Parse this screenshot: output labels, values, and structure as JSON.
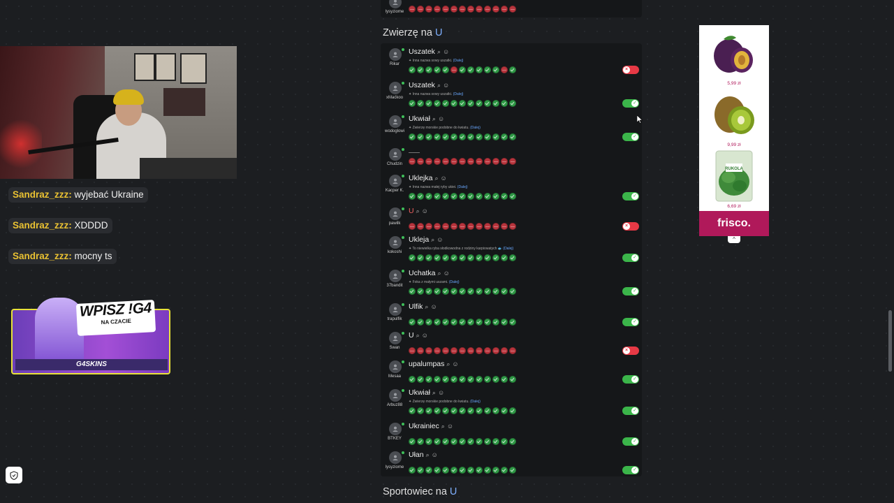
{
  "chat": [
    {
      "user": "Sandraz_zzz:",
      "text": "wyjebać Ukraine"
    },
    {
      "user": "Sandraz_zzz:",
      "text": "XDDDD"
    },
    {
      "user": "Sandraz_zzz:",
      "text": "mocny ts"
    }
  ],
  "promo": {
    "headline": "WPISZ !G4",
    "sub": "NA CZACIE",
    "brand": "G4SKINS"
  },
  "top_row": {
    "username": "lysyziome"
  },
  "section": {
    "title_prefix": "Zwierzę na ",
    "title_letter": "U"
  },
  "next_section": {
    "title_prefix": "Sportowiec na ",
    "title_letter": "U"
  },
  "rows": [
    {
      "username": "Rikar",
      "answer": "Uszatek",
      "hint": "Inna nazwa sowy uszatki.",
      "more": "(Dalej)",
      "pattern": "GGGGGRGGGGGRG",
      "toggle": "off"
    },
    {
      "username": "xMaćkoo",
      "answer": "Uszatek",
      "hint": "Inna nazwa sowy uszatki.",
      "more": "(Dalej)",
      "pattern": "GGGGGGGGGGGGG",
      "toggle": "on"
    },
    {
      "username": "wodoglowi",
      "answer": "Ukwiał",
      "hint": "Zwierzę morskie podobne do kwiatu.",
      "more": "(Dalej)",
      "pattern": "GGGGGGGGGGGGG",
      "toggle": "on"
    },
    {
      "username": "Chudzin",
      "answer": "",
      "hint": "",
      "more": "",
      "pattern": "RRRRRRRRRRRRR",
      "toggle": "none"
    },
    {
      "username": "Kacper K.",
      "answer": "Uklejka",
      "hint": "Inna nazwa małej ryby ukiei.",
      "more": "(Dalej)",
      "pattern": "GGGGGGGGGGGGG",
      "toggle": "on"
    },
    {
      "username": "pawilk",
      "answer": "U",
      "hint": "",
      "more": "",
      "pattern": "RRRRRRRRRRRRR",
      "toggle": "off",
      "red": true
    },
    {
      "username": "kokoshi",
      "answer": "Ukleja",
      "hint": "To niewielka ryba słodkowodna z rodziny karpiowatych 🐟",
      "more": "(Dalej)",
      "pattern": "GGGGGGGGGGGGG",
      "toggle": "on"
    },
    {
      "username": "37bandit",
      "answer": "Uchatka",
      "hint": "Foka z małymi uszami.",
      "more": "(Dalej)",
      "pattern": "GGGGGGGGGGGGG",
      "toggle": "on"
    },
    {
      "username": "trapulfik",
      "answer": "Ulfik",
      "hint": "",
      "more": "",
      "pattern": "GGGGGGGGGGGGG",
      "toggle": "on"
    },
    {
      "username": "Swan",
      "answer": "U",
      "hint": "",
      "more": "",
      "pattern": "RRRRRRRRRRRRR",
      "toggle": "off"
    },
    {
      "username": "Mesaa",
      "answer": "upalumpas",
      "hint": "",
      "more": "",
      "pattern": "GGGGGGGGGGGGG",
      "toggle": "on"
    },
    {
      "username": "Arbuz88",
      "answer": "Ukwiał",
      "hint": "Zwierzę morskie podobne do kwiatu.",
      "more": "(Dalej)",
      "pattern": "GGGGGGGGGGGGG",
      "toggle": "on"
    },
    {
      "username": "BTKEY",
      "answer": "Ukrainiec",
      "hint": "",
      "more": "",
      "pattern": "GGGGGGGGGGGGG",
      "toggle": "on"
    },
    {
      "username": "lysyziome",
      "answer": "Ułan",
      "hint": "",
      "more": "",
      "pattern": "GGGGGGGGGGGGG",
      "toggle": "on"
    }
  ],
  "ad": {
    "prices": [
      "5,99 zł",
      "9,99 zł",
      "6,69 zł"
    ],
    "logo": "frisco.",
    "collapse": "^",
    "product_label": "RUKOLA"
  },
  "colors": {
    "correct": "#2f9a46",
    "wrong": "#b9353d",
    "toggle_on": "#3bb54a",
    "toggle_off": "#e63945",
    "accent": "#7fb0ff",
    "chat_user": "#e9c132"
  }
}
